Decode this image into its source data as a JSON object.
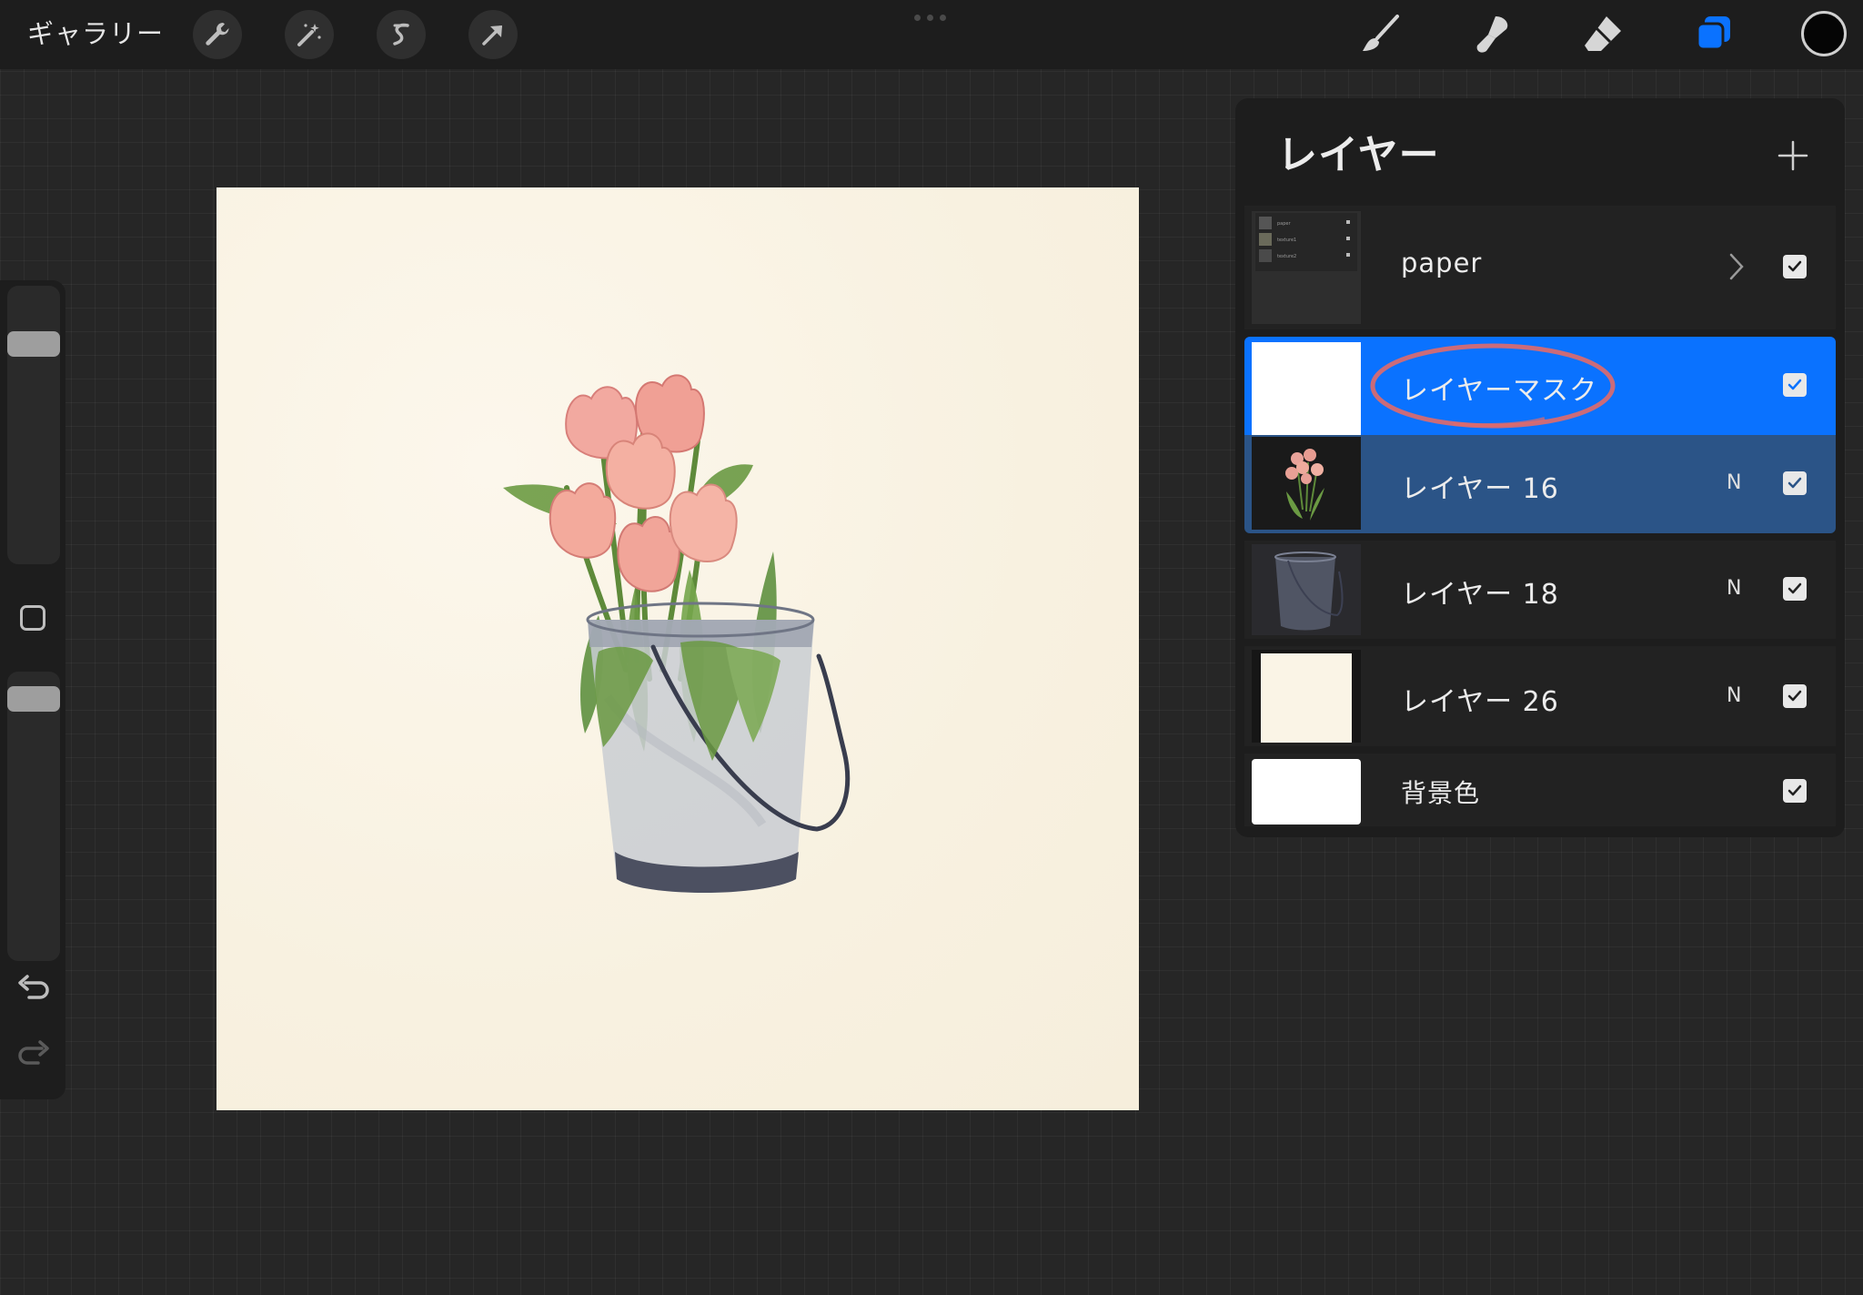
{
  "topbar": {
    "gallery_label": "ギャラリー",
    "left_tools": [
      "wrench-icon",
      "magic-wand-icon",
      "selection-icon",
      "transform-icon"
    ],
    "right_tools": [
      "brush-icon",
      "smudge-icon",
      "eraser-icon",
      "layers-icon"
    ],
    "active_tool": "layers-icon",
    "accent_color": "#0a72ff",
    "current_color": "#050505"
  },
  "sidebar": {
    "brush_size_level": 0.08,
    "opacity_level": 0.05,
    "icons": [
      "modifier-square-icon",
      "undo-icon",
      "redo-icon"
    ]
  },
  "canvas": {
    "background_color": "#faf4e6",
    "artwork": "watercolor tulips in metal bucket",
    "annotation_color": "#e06a6a"
  },
  "layers_panel": {
    "title": "レイヤー",
    "add_icon": "plus-icon",
    "layers": [
      {
        "name": "paper",
        "type": "group",
        "visible": true,
        "expand_icon": "chevron-right-icon",
        "group_thumb_items": [
          "paper",
          "texture1",
          "texture2"
        ]
      },
      {
        "name": "レイヤーマスク",
        "type": "mask",
        "visible": true,
        "selected": true
      },
      {
        "name": "レイヤー 16",
        "blend": "N",
        "visible": true,
        "selected": true
      },
      {
        "name": "レイヤー 18",
        "blend": "N",
        "visible": true
      },
      {
        "name": "レイヤー 26",
        "blend": "N",
        "visible": true
      },
      {
        "name": "背景色",
        "type": "background",
        "visible": true
      }
    ],
    "row_colors": {
      "primary_selected": "#0a72ff",
      "secondary_selected": "#2b5487",
      "normal": "#222222"
    }
  }
}
